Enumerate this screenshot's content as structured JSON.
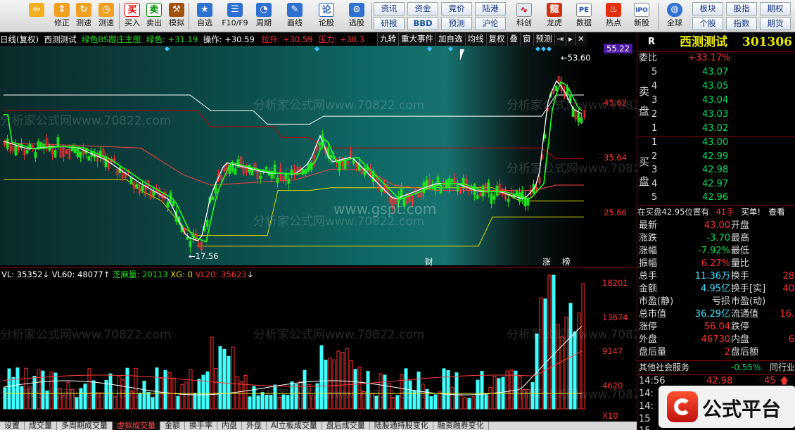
{
  "toolbar": {
    "buttons": [
      {
        "label": "",
        "name": "back-button",
        "icon": "back-arrow-icon",
        "color": "#e8a000"
      },
      {
        "label": "修正",
        "name": "fix-button",
        "icon": "up-down-arrows-icon",
        "color": "#e08000"
      },
      {
        "label": "测速",
        "name": "speed-test-button",
        "icon": "refresh-icon",
        "color": "#e0a000"
      },
      {
        "label": "测速",
        "name": "test-speed-button",
        "icon": "clock-icon",
        "color": "#e0a000"
      },
      {
        "label": "买入",
        "name": "buy-button",
        "icon": "buy-icon",
        "color": "#d00000",
        "text": "买"
      },
      {
        "label": "卖出",
        "name": "sell-button",
        "icon": "sell-icon",
        "color": "#008000",
        "text": "卖"
      },
      {
        "label": "模拟",
        "name": "simulate-button",
        "icon": "hammer-icon",
        "color": "#a05000"
      },
      {
        "label": "自选",
        "name": "watchlist-button",
        "icon": "star-icon",
        "color": "#2060c0"
      },
      {
        "label": "F10/F9",
        "name": "f10-button",
        "icon": "list-icon",
        "color": "#2060c0"
      },
      {
        "label": "周期",
        "name": "period-button",
        "icon": "period-icon",
        "color": "#2060c0"
      },
      {
        "label": "画线",
        "name": "draw-line-button",
        "icon": "pencil-icon",
        "color": "#2060c0"
      },
      {
        "label": "论股",
        "name": "discuss-button",
        "icon": "discuss-icon",
        "color": "#2060c0",
        "text": "论"
      },
      {
        "label": "选股",
        "name": "select-stock-button",
        "icon": "chart-select-icon",
        "color": "#2060c0"
      }
    ],
    "grid": [
      [
        "资讯",
        "资金",
        "竞价",
        "陆港"
      ],
      [
        "研报",
        "BBD",
        "预测",
        "沪伦"
      ]
    ],
    "buttons2": [
      {
        "label": "科创",
        "name": "star-market-button",
        "icon": "wave-chart-icon"
      },
      {
        "label": "龙虎",
        "name": "dragon-tiger-button",
        "icon": "dragon-icon"
      },
      {
        "label": "数据",
        "name": "data-button",
        "icon": "pe-icon",
        "text": "PE"
      },
      {
        "label": "热点",
        "name": "hotspot-button",
        "icon": "fire-icon"
      },
      {
        "label": "新股",
        "name": "ipo-button",
        "icon": "ipo-icon",
        "text": "IPO"
      },
      {
        "label": "全球",
        "name": "global-button",
        "icon": "globe-icon"
      }
    ],
    "grid2": [
      [
        "板块",
        "股指",
        "期权"
      ],
      [
        "个股",
        "指数",
        "期货"
      ]
    ]
  },
  "header": {
    "period": "日线(复权)",
    "stock": "西测测试",
    "indicator": "绿色BS跟庄主图",
    "green_label": "绿色:",
    "green_val": "+31.19",
    "op_label": "操作:",
    "op_val": "+30.59",
    "lasheng_label": "拉升:",
    "lasheng_val": "+30.59",
    "pressure_label": "压力:",
    "pressure_val": "+38.3",
    "buttons": [
      "九转",
      "重大事件",
      "加自选",
      "均线",
      "复权",
      "叠",
      "窗",
      "预测"
    ]
  },
  "chart": {
    "yaxis": [
      "55.22",
      "45.62",
      "35.64",
      "25.66"
    ],
    "high_label": "53.60",
    "low_label": "17.56",
    "event_labels": [
      "财",
      "涨",
      "榜"
    ],
    "watermark": "www.gspt.com",
    "watermark2": "分析家公式网www.70822.com"
  },
  "vol": {
    "header": {
      "vl": "VL: 35352",
      "vl60": "VL60: 48077",
      "zm": "芝麻量: 20113",
      "xg": "XG: 0",
      "vl20": "VL20: 35623"
    },
    "yaxis": [
      "18201",
      "13674",
      "9147",
      "4620",
      "X10"
    ]
  },
  "right": {
    "title": "西测测试",
    "code": "301306",
    "wb_label": "委比",
    "wb_val": "+33.17%",
    "sell_label": [
      "卖",
      "盘"
    ],
    "buy_label": [
      "买",
      "盘"
    ],
    "sells": [
      [
        "5",
        "43.07"
      ],
      [
        "4",
        "43.05"
      ],
      [
        "3",
        "43.04"
      ],
      [
        "2",
        "43.03"
      ],
      [
        "1",
        "43.02"
      ]
    ],
    "buys": [
      [
        "1",
        "43.00"
      ],
      [
        "2",
        "42.99"
      ],
      [
        "3",
        "42.98"
      ],
      [
        "4",
        "42.97"
      ],
      [
        "5",
        "42.96"
      ]
    ],
    "inbuy": "在买盘42.95位置有",
    "inbuy_hands": "41手",
    "inbuy_action": "买单!",
    "inbuy_link": "查看",
    "stats": [
      [
        "最新",
        "43.00",
        "开盘",
        ""
      ],
      [
        "涨跌",
        "-3.70",
        "最高",
        ""
      ],
      [
        "涨幅",
        "-7.92%",
        "最低",
        ""
      ],
      [
        "振幅",
        "6.27%",
        "量比",
        ""
      ],
      [
        "总手",
        "11.36万",
        "换手",
        "28"
      ],
      [
        "金额",
        "4.95亿",
        "换手[实]",
        "40"
      ],
      [
        "市盈(静)",
        "亏损",
        "市盈(动)",
        ""
      ],
      [
        "总市值",
        "36.29亿",
        "流通值",
        "16."
      ],
      [
        "涨停",
        "56.04",
        "跌停",
        ""
      ],
      [
        "外盘",
        "46730",
        "内盘",
        "6"
      ],
      [
        "盘后量",
        "2",
        "盘后额",
        ""
      ]
    ],
    "sector": "其他社会服务",
    "sector_pct": "-0.55%",
    "sector_rank": "同行业",
    "tick": {
      "time": "14:56",
      "price": "42.98",
      "vol": "45"
    },
    "ticks_more": [
      "14:",
      "14:",
      "15",
      "15"
    ],
    "logo": "公式平台"
  },
  "tabs": [
    "设置",
    "成交量",
    "多周期成交量",
    "虚拟成交量",
    "金额",
    "换手率",
    "内盘",
    "外盘",
    "AI立板成交量",
    "盘后成交量",
    "陆股通持股变化",
    "融资融券变化"
  ],
  "colors": {
    "up": "#ff3030",
    "down": "#00e060",
    "yellow": "#e8e800",
    "white": "#ffffff",
    "cyan": "#40ffff"
  }
}
